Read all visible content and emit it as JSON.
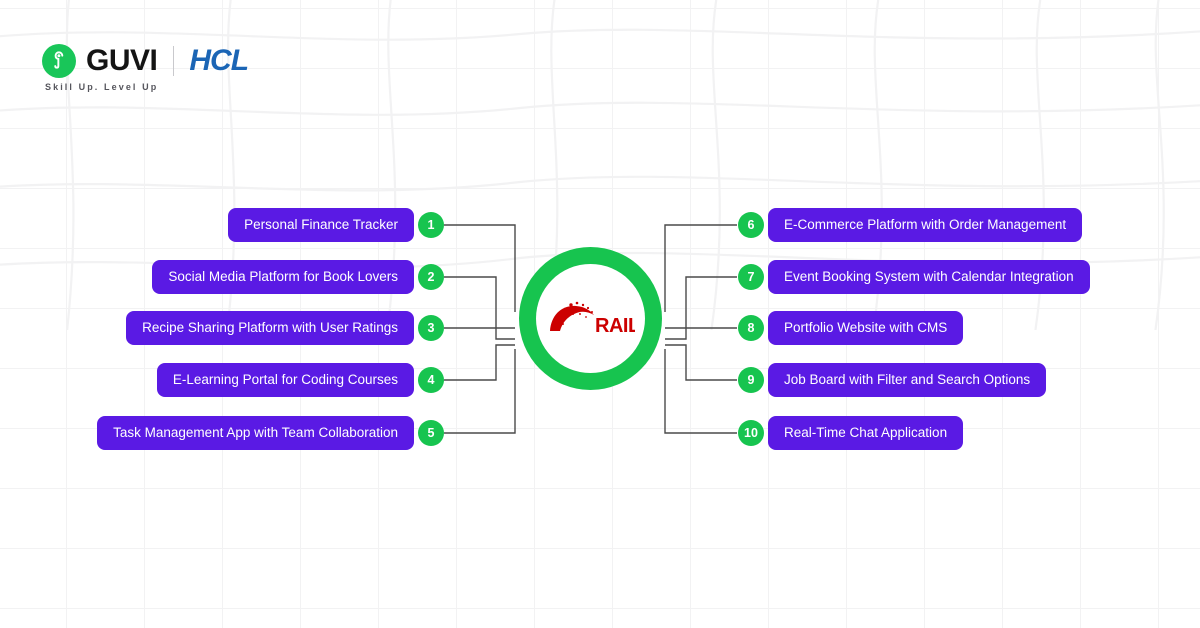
{
  "brand": {
    "guvi_name": "GUVI",
    "hcl_name": "HCL",
    "tagline": "Skill Up. Level Up",
    "guvi_mark_icon": "guvi-g-logo-icon",
    "green": "#17c44f",
    "hcl_blue": "#1b65b5"
  },
  "center": {
    "label": "RAILS",
    "logo_icon": "ruby-on-rails-logo-icon",
    "logo_color": "#cc0000",
    "ring_color": "#17c44f"
  },
  "theme": {
    "pill_purple": "#5a1ae4",
    "badge_green": "#17c44f",
    "connector_gray": "#4a4a4a",
    "background": "#ffffff",
    "grid_line": "#f2f2f3"
  },
  "nodes_left": [
    {
      "number": "1",
      "label": "Personal Finance Tracker"
    },
    {
      "number": "2",
      "label": "Social Media Platform for Book Lovers"
    },
    {
      "number": "3",
      "label": "Recipe Sharing Platform with User Ratings"
    },
    {
      "number": "4",
      "label": "E-Learning Portal for Coding Courses"
    },
    {
      "number": "5",
      "label": "Task Management App with Team Collaboration"
    }
  ],
  "nodes_right": [
    {
      "number": "6",
      "label": "E-Commerce Platform with Order Management"
    },
    {
      "number": "7",
      "label": "Event Booking System with Calendar Integration"
    },
    {
      "number": "8",
      "label": "Portfolio Website with CMS"
    },
    {
      "number": "9",
      "label": "Job Board with Filter and Search Options"
    },
    {
      "number": "10",
      "label": "Real-Time Chat Application"
    }
  ]
}
